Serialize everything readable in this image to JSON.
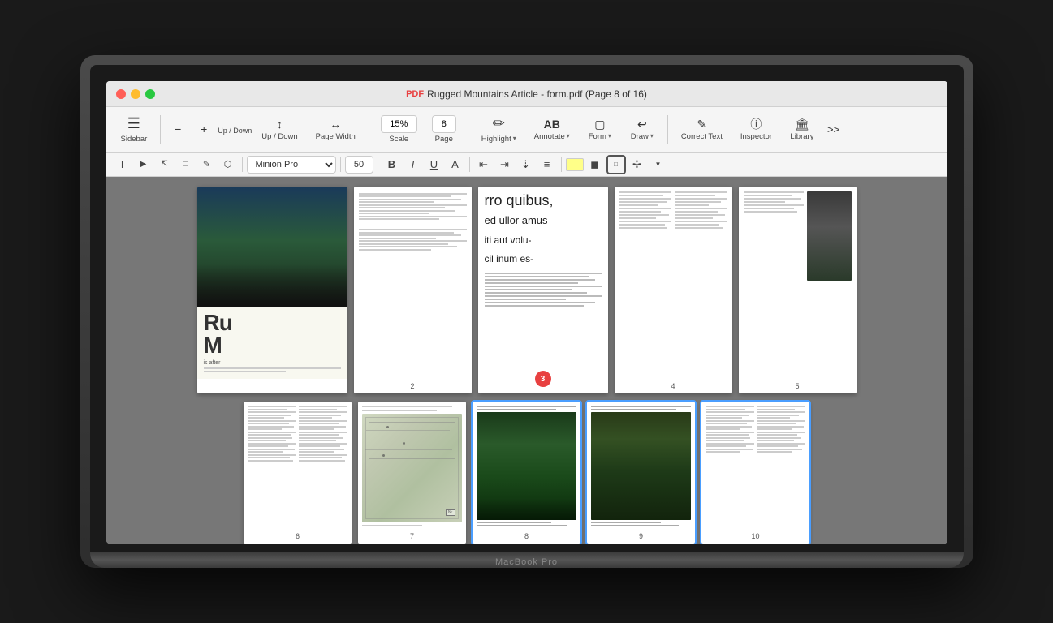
{
  "window": {
    "title": "Rugged Mountains Article - form.pdf (Page 8 of 16)",
    "pdf_icon": "PDF"
  },
  "traffic_lights": {
    "red": "close",
    "yellow": "minimize",
    "green": "maximize"
  },
  "toolbar": {
    "sidebar_label": "Sidebar",
    "zoom_minus_label": "−",
    "zoom_plus_label": "+",
    "up_down_label": "Up / Down",
    "page_width_label": "Page Width",
    "scale_label": "Scale",
    "scale_value": "15%",
    "page_value": "8",
    "page_label": "Page",
    "highlight_label": "Highlight",
    "annotate_label": "Annotate",
    "annotate_icon": "AB",
    "form_label": "Form",
    "draw_label": "Draw",
    "correct_text_label": "Correct Text",
    "inspector_label": "Inspector",
    "library_label": "Library",
    "more_label": ">>"
  },
  "secondary_toolbar": {
    "cursor_tools": [
      "I",
      "↖",
      "↖",
      "⊡",
      "✎",
      "⬡"
    ],
    "font_name": "Minion Pro",
    "font_size": "50",
    "format_buttons": [
      "B",
      "I",
      "U",
      "A"
    ],
    "align_buttons": [
      "≡",
      "≡",
      "≡",
      "≡"
    ],
    "color_buttons": [
      "yellow",
      "highlight",
      "border",
      "more",
      "chevron"
    ]
  },
  "pages": {
    "row1": [
      {
        "num": "",
        "type": "cover",
        "has_image": true,
        "badge": null
      },
      {
        "num": "2",
        "type": "spread",
        "has_image": false,
        "badge": null
      },
      {
        "num": "3",
        "type": "article",
        "has_image": false,
        "badge": "3"
      },
      {
        "num": "4",
        "type": "text",
        "has_image": false,
        "badge": null
      },
      {
        "num": "5",
        "type": "text-image",
        "has_image": true,
        "badge": null
      }
    ],
    "row2": [
      {
        "num": "6",
        "type": "text",
        "highlighted": false
      },
      {
        "num": "7",
        "type": "map",
        "highlighted": false
      },
      {
        "num": "8",
        "type": "forest",
        "highlighted": true
      },
      {
        "num": "9",
        "type": "forest2",
        "highlighted": true
      },
      {
        "num": "10",
        "type": "text2",
        "highlighted": true
      }
    ],
    "row3": [
      {
        "num": "",
        "type": "text-small"
      },
      {
        "num": "",
        "type": "text-small"
      },
      {
        "num": "",
        "type": "text-small"
      },
      {
        "num": "",
        "type": "text-small"
      },
      {
        "num": "",
        "type": "text-small"
      }
    ]
  },
  "macbook_label": "MacBook Pro"
}
